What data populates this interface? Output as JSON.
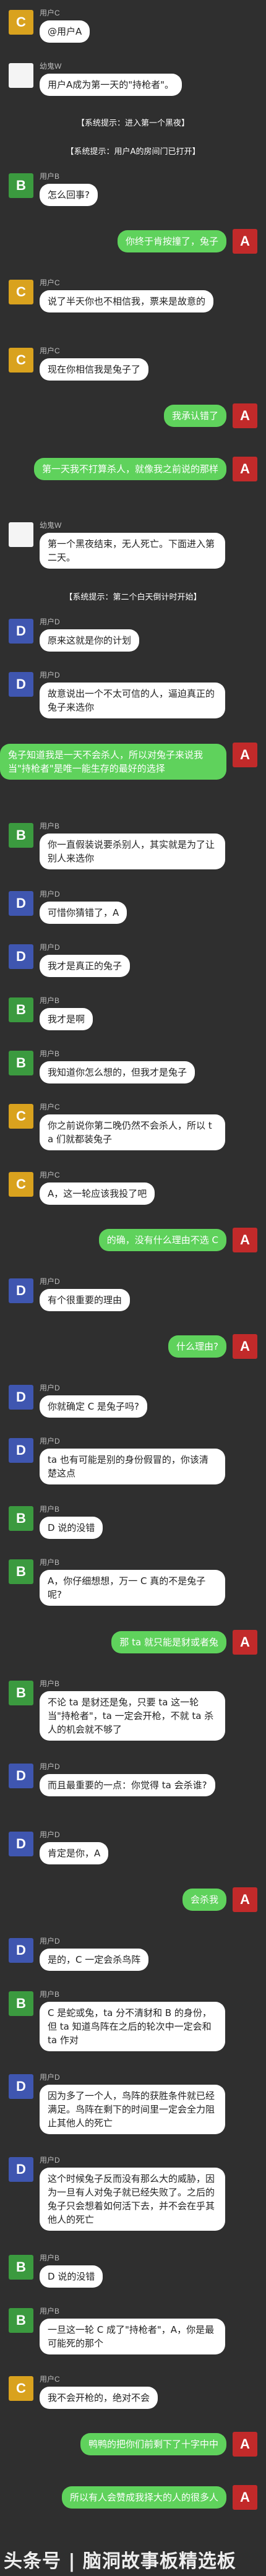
{
  "watermark": "头条号 | 脑洞故事板精选板",
  "messages": [
    {
      "type": "left",
      "avatar": "C",
      "sender": "用户C",
      "text": "@用户A",
      "size": "normal"
    },
    {
      "type": "left",
      "avatar": "W",
      "sender": "幼鬼W",
      "text": "用户A成为第一天的\"持枪者\"。",
      "size": "normal"
    },
    {
      "type": "system",
      "text": "【系统提示：进入第一个黑夜】"
    },
    {
      "type": "system",
      "text": "【系统提示：用户A的房间门已打开】"
    },
    {
      "type": "left",
      "avatar": "B",
      "sender": "用户B",
      "text": "怎么回事?",
      "size": "normal"
    },
    {
      "type": "right",
      "avatar": "A",
      "text": "你终于肯按撞了，兔子",
      "size": "normal"
    },
    {
      "type": "left",
      "avatar": "C",
      "sender": "用户C",
      "text": "说了半天你也不相信我，票来是故意的",
      "size": "tall"
    },
    {
      "type": "left",
      "avatar": "C",
      "sender": "用户C",
      "text": "现在你相信我是兔子了",
      "size": "normal"
    },
    {
      "type": "right",
      "avatar": "A",
      "text": "我承认错了",
      "size": "normal"
    },
    {
      "type": "right",
      "avatar": "A",
      "text": "第一天我不打算杀人，就像我之前说的那样",
      "size": "tall"
    },
    {
      "type": "left",
      "avatar": "W",
      "sender": "幼鬼W",
      "text": "第一个黑夜结束，无人死亡。下面进入第二天。",
      "size": "tall"
    },
    {
      "type": "system",
      "text": "【系统提示：第二个白天倒计时开始】"
    },
    {
      "type": "left",
      "avatar": "D",
      "sender": "用户D",
      "text": "原来这就是你的计划",
      "size": "normal"
    },
    {
      "type": "left",
      "avatar": "D",
      "sender": "用户D",
      "text": "故意说出一个不太可信的人，逼迫真正的兔子来选你",
      "size": "tall"
    },
    {
      "type": "right",
      "avatar": "A",
      "text": "兔子知道我是一天不会杀人，所以对兔子来说我当\"持枪者\"是唯一能生存的最好的选择",
      "size": "taller"
    },
    {
      "type": "left",
      "avatar": "B",
      "sender": "用户B",
      "text": "你一直假装说要杀别人，其实就是为了让别人来选你",
      "size": "tall"
    },
    {
      "type": "left",
      "avatar": "D",
      "sender": "用户D",
      "text": "可惜你猜错了，A",
      "size": "normal"
    },
    {
      "type": "left",
      "avatar": "D",
      "sender": "用户D",
      "text": "我才是真正的兔子",
      "size": "normal"
    },
    {
      "type": "left",
      "avatar": "B",
      "sender": "用户B",
      "text": "我才是啊",
      "size": "normal"
    },
    {
      "type": "left",
      "avatar": "B",
      "sender": "用户B",
      "text": "我知道你怎么想的，但我才是兔子",
      "size": "normal"
    },
    {
      "type": "left",
      "avatar": "C",
      "sender": "用户C",
      "text": "你之前说你第二晚仍然不会杀人，所以 ta 们就都装兔子",
      "size": "tall"
    },
    {
      "type": "left",
      "avatar": "C",
      "sender": "用户C",
      "text": "A，这一轮应该我投了吧",
      "size": "normal"
    },
    {
      "type": "right",
      "avatar": "A",
      "text": "的确，没有什么理由不选 C",
      "size": "normal"
    },
    {
      "type": "left",
      "avatar": "D",
      "sender": "用户D",
      "text": "有个很重要的理由",
      "size": "normal"
    },
    {
      "type": "right",
      "avatar": "A",
      "text": "什么理由?",
      "size": "normal"
    },
    {
      "type": "left",
      "avatar": "D",
      "sender": "用户D",
      "text": "你就确定 C 是兔子吗?",
      "size": "normal"
    },
    {
      "type": "left",
      "avatar": "D",
      "sender": "用户D",
      "text": "ta 也有可能是别的身份假冒的，你该清楚这点",
      "size": "tall"
    },
    {
      "type": "left",
      "avatar": "B",
      "sender": "用户B",
      "text": "D 说的没错",
      "size": "normal"
    },
    {
      "type": "left",
      "avatar": "B",
      "sender": "用户B",
      "text": "A，你仔细想想，万一 C 真的不是兔子呢?",
      "size": "tall"
    },
    {
      "type": "right",
      "avatar": "A",
      "text": "那 ta 就只能是豺或者兔",
      "size": "normal"
    },
    {
      "type": "left",
      "avatar": "B",
      "sender": "用户B",
      "text": "不论 ta 是豺还是兔，只要 ta 这一轮当\"持枪者\"，ta 一定会开枪，不就 ta 杀人的机会就不够了",
      "size": "taller"
    },
    {
      "type": "left",
      "avatar": "D",
      "sender": "用户D",
      "text": "而且最重要的一点：你觉得 ta 会杀谁?",
      "size": "tall"
    },
    {
      "type": "left",
      "avatar": "D",
      "sender": "用户D",
      "text": "肯定是你，A",
      "size": "normal"
    },
    {
      "type": "right",
      "avatar": "A",
      "text": "会杀我",
      "size": "normal"
    },
    {
      "type": "left",
      "avatar": "D",
      "sender": "用户D",
      "text": "是的，C 一定会杀鸟阵",
      "size": "normal"
    },
    {
      "type": "left",
      "avatar": "B",
      "sender": "用户B",
      "text": "C 是蛇或兔，ta 分不清豺和 B 的身份，但 ta 知道鸟阵在之后的轮次中一定会和 ta 作对",
      "size": "taller"
    },
    {
      "type": "left",
      "avatar": "D",
      "sender": "用户D",
      "text": "因为多了一个人，鸟阵的获胜条件就已经满足。鸟阵在剩下的时间里一定会全力阻止其他人的死亡",
      "size": "taller"
    },
    {
      "type": "left",
      "avatar": "D",
      "sender": "用户D",
      "text": "这个时候兔子反而没有那么大的威胁，因为一旦有人对兔子就已经失败了。之后的兔子只会想着如何活下去，并不会在乎其他人的死亡",
      "size": "tallest"
    },
    {
      "type": "left",
      "avatar": "B",
      "sender": "用户B",
      "text": "D 说的没错",
      "size": "normal"
    },
    {
      "type": "left",
      "avatar": "B",
      "sender": "用户B",
      "text": "一旦这一轮 C 成了\"持枪者\"，A，你是最可能死的那个",
      "size": "tall"
    },
    {
      "type": "left",
      "avatar": "C",
      "sender": "用户C",
      "text": "我不会开枪的，绝对不会",
      "size": "normal"
    },
    {
      "type": "right",
      "avatar": "A",
      "text": "鸭鸭的把你们前剩下了十字中中",
      "size": "normal"
    },
    {
      "type": "right",
      "avatar": "A",
      "text": "所以有人会赞成我择大的人的很多人",
      "size": "normal"
    }
  ]
}
